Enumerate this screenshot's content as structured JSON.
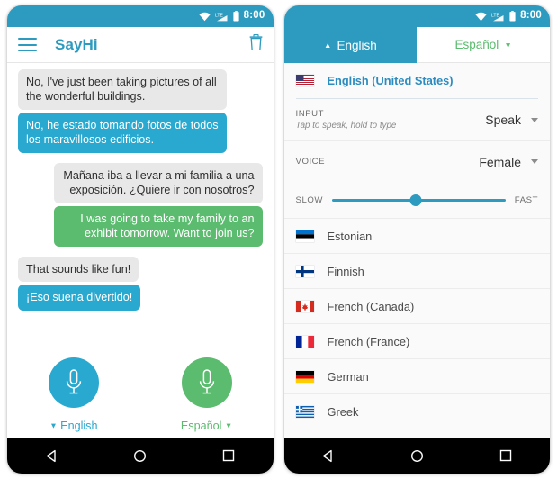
{
  "status_bar": {
    "time": "8:00",
    "icons": [
      "wifi-icon",
      "lte-signal-icon",
      "battery-icon"
    ]
  },
  "left_phone": {
    "app_bar": {
      "menu_icon": "hamburger-menu-icon",
      "title": "SayHi",
      "delete_icon": "trash-icon"
    },
    "messages": [
      {
        "text": "No, I've just been taking pictures of all the wonderful buildings.",
        "type": "source",
        "align": "left"
      },
      {
        "text": "No, he estado tomando fotos de todos los maravillosos edificios.",
        "type": "translation-blue",
        "align": "left"
      },
      {
        "text": "Mañana iba a llevar a mi familia a una exposición. ¿Quiere ir con nosotros?",
        "type": "source",
        "align": "right"
      },
      {
        "text": "I was going to take my family to an exhibit tomorrow. Want to join us?",
        "type": "translation-green",
        "align": "right"
      },
      {
        "text": "That sounds like fun!",
        "type": "source",
        "align": "left"
      },
      {
        "text": "¡Eso suena divertido!",
        "type": "translation-blue",
        "align": "left"
      }
    ],
    "mic_left": {
      "icon": "microphone-icon",
      "color": "#29A9D0"
    },
    "mic_right": {
      "icon": "microphone-icon",
      "color": "#5BBB6E"
    },
    "lang_left": {
      "caret": "▼",
      "label": "English"
    },
    "lang_right": {
      "label": "Español",
      "caret": "▼"
    }
  },
  "right_phone": {
    "tabs": [
      {
        "caret": "▲",
        "label": "English",
        "active": true
      },
      {
        "label": "Español",
        "caret": "▼",
        "active": false
      }
    ],
    "selected_language": {
      "name": "English (United States)",
      "flag": "flag-united-states"
    },
    "settings": {
      "input": {
        "label": "INPUT",
        "hint": "Tap to speak, hold to type",
        "value": "Speak"
      },
      "voice": {
        "label": "VOICE",
        "value": "Female"
      },
      "speed": {
        "min_label": "SLOW",
        "max_label": "FAST",
        "value_percent": 48
      }
    },
    "languages": [
      {
        "name": "Estonian",
        "flag": "flag-estonia"
      },
      {
        "name": "Finnish",
        "flag": "flag-finland"
      },
      {
        "name": "French (Canada)",
        "flag": "flag-canada"
      },
      {
        "name": "French (France)",
        "flag": "flag-france"
      },
      {
        "name": "German",
        "flag": "flag-germany"
      },
      {
        "name": "Greek",
        "flag": "flag-greece"
      }
    ]
  },
  "nav_bar": {
    "back": "back-triangle-icon",
    "home": "home-circle-icon",
    "recents": "recents-square-icon"
  },
  "colors": {
    "primary": "#2D9BBF",
    "bubble_blue": "#29A9D0",
    "bubble_green": "#5BBB6E",
    "bubble_gray": "#e8e8e8"
  }
}
